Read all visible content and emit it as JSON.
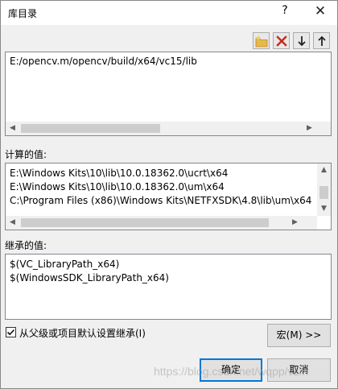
{
  "window": {
    "title": "库目录",
    "help_label": "?",
    "close_label": "✕"
  },
  "toolbar": {
    "icons": [
      "new-line-folder-icon",
      "delete-icon",
      "move-down-icon",
      "move-up-icon"
    ],
    "delete_color": "#c42b1c"
  },
  "edit_box": {
    "lines": [
      "E:/opencv.m/opencv/build/x64/vc15/lib"
    ]
  },
  "computed": {
    "label": "计算的值:",
    "lines": [
      "E:\\Windows Kits\\10\\lib\\10.0.18362.0\\ucrt\\x64",
      "E:\\Windows Kits\\10\\lib\\10.0.18362.0\\um\\x64",
      "C:\\Program Files (x86)\\Windows Kits\\NETFXSDK\\4.8\\lib\\um\\x64"
    ]
  },
  "inherited": {
    "label": "继承的值:",
    "lines": [
      "$(VC_LibraryPath_x64)",
      "$(WindowsSDK_LibraryPath_x64)"
    ]
  },
  "inherit_checkbox": {
    "label": "从父级或项目默认设置继承(I)",
    "checked": true
  },
  "buttons": {
    "macro": "宏(M) >>",
    "ok": "确定",
    "cancel": "取消"
  },
  "watermark": "https://blog.csdn.net/wqpp/vzm"
}
